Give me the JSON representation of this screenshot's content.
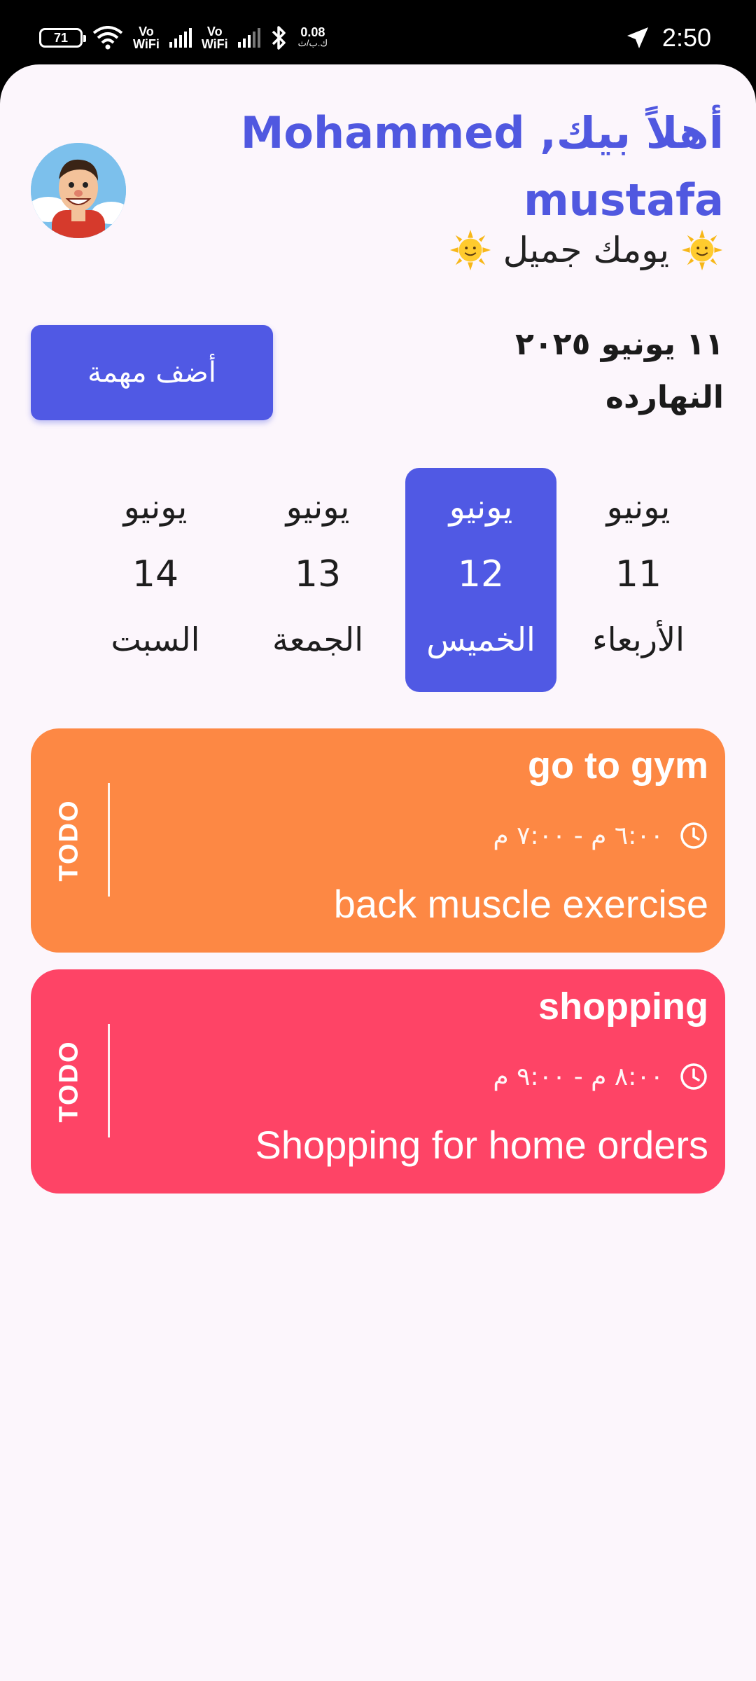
{
  "status_bar": {
    "battery": "71",
    "vo_wifi_1": "Vo\nWiFi",
    "vo_wifi_2": "Vo\nWiFi",
    "speed_value": "0.08",
    "speed_unit": "ك.ب/ث",
    "time": "2:50"
  },
  "header": {
    "greeting": "أهلاً بيك, Mohammed mustafa",
    "subtitle": "يومك جميل",
    "avatar_icon": "cartoon-man-avatar"
  },
  "date_section": {
    "date": "١١ يونيو ٢٠٢٥",
    "today_label": "النهارده",
    "add_task_label": "أضف مهمة"
  },
  "days": [
    {
      "month": "يونيو",
      "number": "11",
      "weekday": "الأربعاء",
      "selected": false
    },
    {
      "month": "يونيو",
      "number": "12",
      "weekday": "الخميس",
      "selected": true
    },
    {
      "month": "يونيو",
      "number": "13",
      "weekday": "الجمعة",
      "selected": false
    },
    {
      "month": "يونيو",
      "number": "14",
      "weekday": "السبت",
      "selected": false
    }
  ],
  "tasks": [
    {
      "title": "go to gym",
      "time": "٦:٠٠ م - ٧:٠٠ م",
      "description": "back muscle exercise",
      "status": "TODO",
      "color": "#fd8844"
    },
    {
      "title": "shopping",
      "time": "٨:٠٠ م - ٩:٠٠ م",
      "description": "Shopping for home orders",
      "status": "TODO",
      "color": "#fe4466"
    }
  ],
  "colors": {
    "primary": "#5059e4",
    "background": "#fcf6fc",
    "greeting_text": "#5058e0"
  }
}
